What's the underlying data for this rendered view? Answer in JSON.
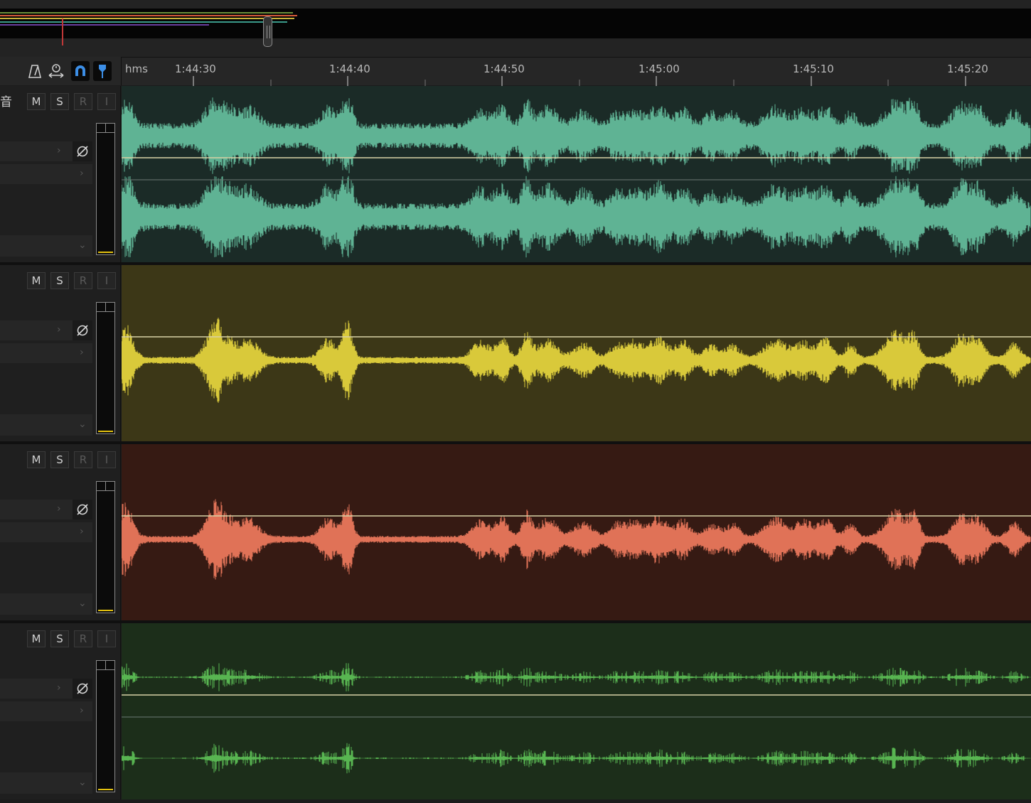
{
  "overview": {
    "lines": [
      {
        "color": "#6b8f3a"
      },
      {
        "color": "#d65a3a"
      },
      {
        "color": "#c9b23a"
      },
      {
        "color": "#6a3fa0"
      },
      {
        "color": "#3a9a8a"
      }
    ]
  },
  "toolbar": {
    "tools": [
      {
        "icon": "metronome-icon"
      },
      {
        "icon": "time-stretch-icon"
      },
      {
        "icon": "snap-magnet-icon",
        "active": true
      },
      {
        "icon": "marker-pin-icon",
        "active": true
      }
    ]
  },
  "ruler": {
    "unit": "hms",
    "labels": [
      "1:44:30",
      "1:44:40",
      "1:44:50",
      "1:45:00",
      "1:45:10",
      "1:45:20"
    ]
  },
  "tracks": [
    {
      "name": "音",
      "mute": "M",
      "solo": "S",
      "record": "R",
      "input": "I",
      "phase_icon": "phase-invert-icon",
      "color": "#5fb394",
      "background": "#1b2b27",
      "stereo": true
    },
    {
      "name": "",
      "mute": "M",
      "solo": "S",
      "record": "R",
      "input": "I",
      "phase_icon": "phase-invert-icon",
      "color": "#d9c93a",
      "background": "#3c3717",
      "stereo": false
    },
    {
      "name": "",
      "mute": "M",
      "solo": "S",
      "record": "R",
      "input": "I",
      "phase_icon": "phase-invert-icon",
      "color": "#e07257",
      "background": "#361a13",
      "stereo": false
    },
    {
      "name": "",
      "mute": "M",
      "solo": "S",
      "record": "R",
      "input": "I",
      "phase_icon": "phase-invert-icon",
      "color": "#58b551",
      "background": "#1c2e1a",
      "stereo": true
    }
  ]
}
